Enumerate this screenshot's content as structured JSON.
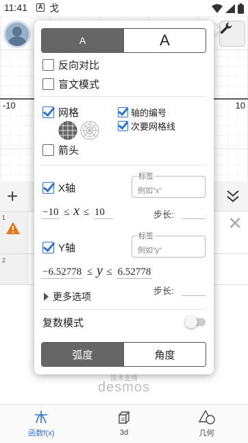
{
  "status_bar": {
    "time": "11:41",
    "icon_a": "A",
    "misc": "戈"
  },
  "graph": {
    "x_tick_neg": "-10",
    "x_tick_pos": "10"
  },
  "settings": {
    "font_size_small": "A",
    "font_size_large": "A",
    "reverse_contrast": "反向对比",
    "braille_mode": "盲文模式",
    "grid": "网格",
    "axis_numbers": "轴的编号",
    "minor_gridlines": "次要网格线",
    "arrows": "箭头",
    "x_axis": {
      "label": "X轴",
      "label_field_title": "标签",
      "label_placeholder": "例如\"x\"",
      "min": "−10",
      "max": "10",
      "variable": "x",
      "leq": "≤",
      "step_label": "步长:"
    },
    "y_axis": {
      "label": "Y轴",
      "label_field_title": "标签",
      "label_placeholder": "例如\"y\"",
      "min": "−6.52778",
      "max": "6.52778",
      "variable": "y",
      "leq": "≤",
      "step_label": "步长:"
    },
    "more_options": "更多选项",
    "complex_mode": "复数模式",
    "radians": "弧度",
    "degrees": "角度"
  },
  "expressions": {
    "row1_index": "1",
    "row2_index": "2"
  },
  "branding": {
    "powered_by": "技术支持",
    "name": "desmos"
  },
  "bottom_nav": [
    {
      "label": "函数f(x)",
      "icon": "function-icon"
    },
    {
      "label": "3d",
      "icon": "cube-3d-icon"
    },
    {
      "label": "几何",
      "icon": "geometry-icon"
    }
  ],
  "colors": {
    "accent": "#2f6fd8",
    "warning": "#e8771a"
  }
}
